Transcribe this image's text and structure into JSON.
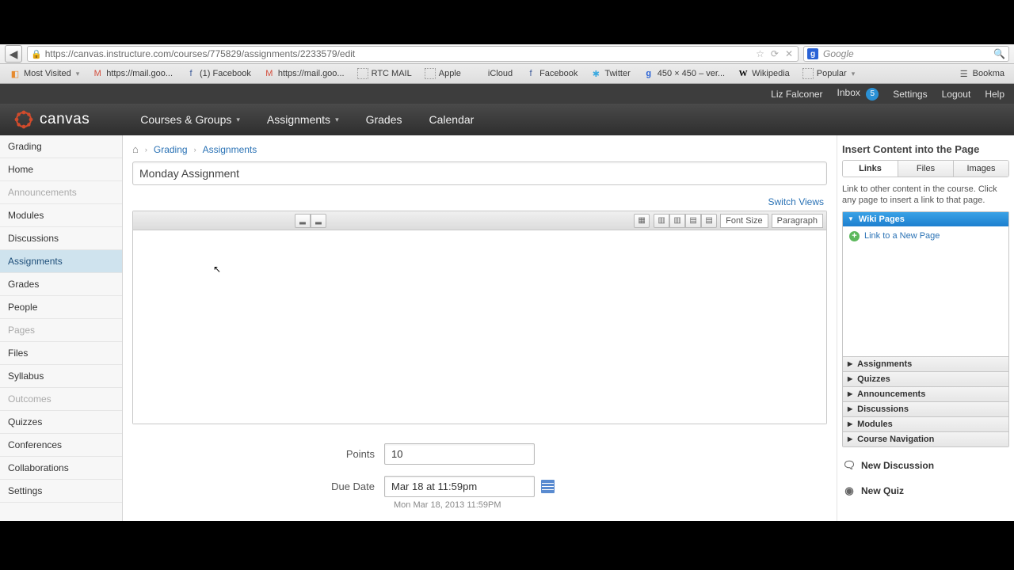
{
  "browser": {
    "url": "https://canvas.instructure.com/courses/775829/assignments/2233579/edit",
    "search_engine_letter": "g",
    "search_placeholder": "Google",
    "bookmarks": [
      {
        "icon": "orange",
        "label": "Most Visited",
        "menu": true
      },
      {
        "icon": "mail",
        "label": "https://mail.goo..."
      },
      {
        "icon": "fb",
        "label": "(1) Facebook"
      },
      {
        "icon": "mail",
        "label": "https://mail.goo..."
      },
      {
        "icon": "dotted",
        "label": "RTC MAIL"
      },
      {
        "icon": "dotted",
        "label": "Apple"
      },
      {
        "icon": "apple",
        "label": "iCloud"
      },
      {
        "icon": "fb",
        "label": "Facebook"
      },
      {
        "icon": "twitter",
        "label": "Twitter"
      },
      {
        "icon": "google",
        "label": "450 × 450 – ver..."
      },
      {
        "icon": "wiki",
        "label": "Wikipedia"
      },
      {
        "icon": "dotted",
        "label": "Popular",
        "menu": true
      }
    ],
    "bookmarks_right_label": "Bookma"
  },
  "userbar": {
    "user": "Liz Falconer",
    "inbox_label": "Inbox",
    "inbox_count": "5",
    "settings": "Settings",
    "logout": "Logout",
    "help": "Help"
  },
  "brand": "canvas",
  "topnav": [
    {
      "label": "Courses & Groups",
      "menu": true
    },
    {
      "label": "Assignments",
      "menu": true
    },
    {
      "label": "Grades",
      "menu": false
    },
    {
      "label": "Calendar",
      "menu": false
    }
  ],
  "leftnav": [
    {
      "label": "Grading",
      "state": ""
    },
    {
      "label": "Home",
      "state": ""
    },
    {
      "label": "Announcements",
      "state": "muted"
    },
    {
      "label": "Modules",
      "state": ""
    },
    {
      "label": "Discussions",
      "state": ""
    },
    {
      "label": "Assignments",
      "state": "active"
    },
    {
      "label": "Grades",
      "state": ""
    },
    {
      "label": "People",
      "state": ""
    },
    {
      "label": "Pages",
      "state": "muted"
    },
    {
      "label": "Files",
      "state": ""
    },
    {
      "label": "Syllabus",
      "state": ""
    },
    {
      "label": "Outcomes",
      "state": "muted"
    },
    {
      "label": "Quizzes",
      "state": ""
    },
    {
      "label": "Conferences",
      "state": ""
    },
    {
      "label": "Collaborations",
      "state": ""
    },
    {
      "label": "Settings",
      "state": ""
    }
  ],
  "crumbs": {
    "a": "Grading",
    "b": "Assignments"
  },
  "form": {
    "title_value": "Monday Assignment",
    "switch_views": "Switch Views",
    "font_size_label": "Font Size",
    "paragraph_label": "Paragraph",
    "points_label": "Points",
    "points_value": "10",
    "due_label": "Due Date",
    "due_value": "Mar 18 at 11:59pm",
    "due_help": "Mon Mar 18, 2013 11:59PM"
  },
  "right": {
    "title": "Insert Content into the Page",
    "tabs": [
      "Links",
      "Files",
      "Images"
    ],
    "desc": "Link to other content in the course. Click any page to insert a link to that page.",
    "acc": [
      {
        "label": "Wiki Pages",
        "active": true
      },
      {
        "label": "Assignments"
      },
      {
        "label": "Quizzes"
      },
      {
        "label": "Announcements"
      },
      {
        "label": "Discussions"
      },
      {
        "label": "Modules"
      },
      {
        "label": "Course Navigation"
      }
    ],
    "new_page_label": "Link to a New Page",
    "action_discussion": "New Discussion",
    "action_quiz": "New Quiz"
  }
}
